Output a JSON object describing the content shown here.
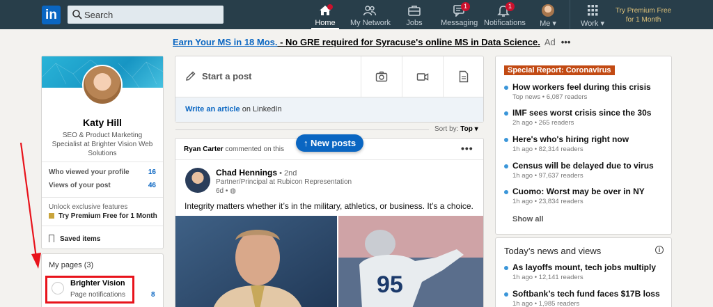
{
  "nav": {
    "logo": "in",
    "search_placeholder": "Search",
    "items": [
      {
        "label": "Home",
        "badge": ""
      },
      {
        "label": "My Network",
        "badge": ""
      },
      {
        "label": "Jobs",
        "badge": ""
      },
      {
        "label": "Messaging",
        "badge": "1"
      },
      {
        "label": "Notifications",
        "badge": "1"
      },
      {
        "label": "Me ▾",
        "badge": ""
      },
      {
        "label": "Work ▾",
        "badge": ""
      }
    ],
    "premium_line1": "Try Premium Free",
    "premium_line2": "for 1 Month"
  },
  "ad": {
    "link": "Earn Your MS in 18 Mos.",
    "rest": " - No GRE required for Syracuse's online MS in Data Science.",
    "label": "Ad",
    "dots": "•••"
  },
  "profile": {
    "name": "Katy Hill",
    "title": "SEO & Product Marketing Specialist at Brighter Vision Web Solutions",
    "stats": [
      {
        "label": "Who viewed your profile",
        "value": "16"
      },
      {
        "label": "Views of your post",
        "value": "46"
      }
    ],
    "unlock": "Unlock exclusive features",
    "premium": "Try Premium Free for 1 Month",
    "saved": "Saved items"
  },
  "pages": {
    "title": "My pages (3)",
    "name": "Brighter Vision",
    "notif": "Page notifications",
    "count": "8"
  },
  "composer": {
    "start": "Start a post",
    "write_link": "Write an article",
    "write_rest": " on LinkedIn"
  },
  "sort": {
    "label": "Sort by:",
    "value": "Top ▾"
  },
  "feed": {
    "commenter": "Ryan Carter",
    "commented": " commented on this",
    "new_posts": "↑ New posts",
    "author": "Chad Hennings",
    "degree": " • 2nd",
    "author_title": "Partner/Principal at Rubicon Representation",
    "time": "6d • ",
    "text": "Integrity matters whether it’s in the military, athletics, or business. It’s a choice."
  },
  "news": {
    "badge": "Special Report: Coronavirus",
    "items": [
      {
        "headline": "How workers feel during this crisis",
        "meta": "Top news • 6,087 readers"
      },
      {
        "headline": "IMF sees worst crisis since the 30s",
        "meta": "2h ago • 265 readers"
      },
      {
        "headline": "Here's who's hiring right now",
        "meta": "1h ago • 82,314 readers"
      },
      {
        "headline": "Census will be delayed due to virus",
        "meta": "1h ago • 97,637 readers"
      },
      {
        "headline": "Cuomo: Worst may be over in NY",
        "meta": "1h ago • 23,834 readers"
      }
    ],
    "show_all": "Show all"
  },
  "today": {
    "title": "Today’s news and views",
    "items": [
      {
        "headline": "As layoffs mount, tech jobs multiply",
        "meta": "1h ago • 12,141 readers"
      },
      {
        "headline": "Softbank’s tech fund faces $17B loss",
        "meta": "1h ago • 1,985 readers"
      }
    ]
  },
  "colors": {
    "nav_bg": "#283e4a",
    "accent": "#0a66c2",
    "highlight": "#e8131b",
    "special": "#c24a13"
  }
}
